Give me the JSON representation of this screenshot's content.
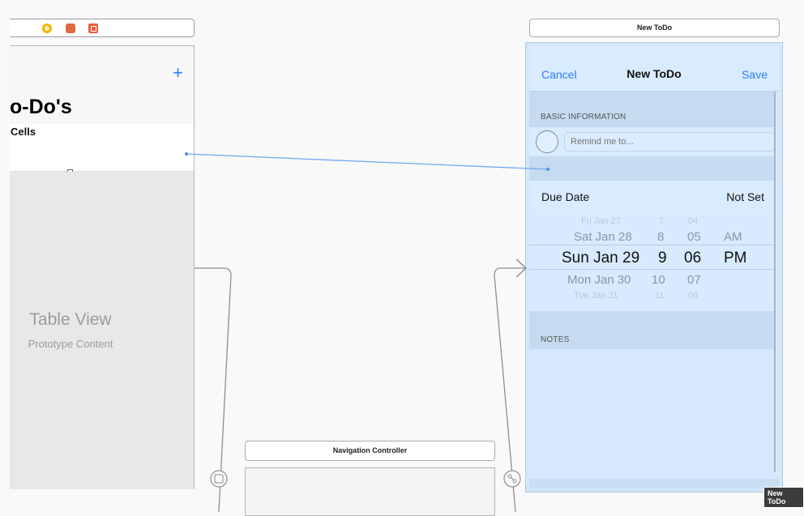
{
  "left_scene": {
    "plus_glyph": "+",
    "large_title": "o-Do's",
    "cells_header": "Cells",
    "table_view_title": "Table View",
    "table_view_subtitle": "Prototype Content"
  },
  "nav_controller": {
    "label": "Navigation Controller"
  },
  "right_scene": {
    "dock_title": "New ToDo",
    "nav": {
      "cancel": "Cancel",
      "title": "New ToDo",
      "save": "Save"
    },
    "basic_info_header": "BASIC INFORMATION",
    "remind_placeholder": "Remind me to...",
    "due_date_label": "Due Date",
    "due_date_value": "Not Set",
    "picker": {
      "dates": [
        "Fri Jan 27",
        "Sat Jan 28",
        "Sun Jan 29",
        "Mon Jan 30",
        "Tue Jan 31"
      ],
      "hours": [
        "7",
        "8",
        "9",
        "10",
        "11"
      ],
      "minutes": [
        "04",
        "05",
        "06",
        "07",
        "08"
      ],
      "ampm": [
        "AM",
        "PM"
      ]
    },
    "notes_header": "NOTES"
  },
  "tooltip": "New ToDo",
  "colors": {
    "accent": "#2f7cf6",
    "segue_line": "#6fa9f3",
    "scene_tint": "#d6e8fd"
  }
}
